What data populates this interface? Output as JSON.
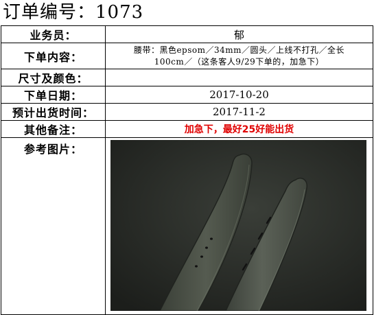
{
  "title": "订单编号：1073",
  "rows": {
    "salesperson": {
      "label": "业务员：",
      "value": "郁"
    },
    "order_content": {
      "label": "下单内容：",
      "line1": "腰带：黑色epsom／34mm／圆头／上线不打孔／全长",
      "line2": "100cm／（这条客人9/29下单的，加急下）"
    },
    "size_color": {
      "label": "尺寸及颜色：",
      "value": ""
    },
    "order_date": {
      "label": "下单日期：",
      "value": "2017-10-20"
    },
    "ship_date": {
      "label": "预计出货时间：",
      "value": "2017-11-2"
    },
    "notes": {
      "label": "其他备注：",
      "value": "加急下，最好25好能出货"
    },
    "photo": {
      "label": "参考图片："
    }
  },
  "colors": {
    "note_red": "#e00000",
    "photo_bg": "#2c2f2a",
    "strap": "#4a4f46"
  }
}
